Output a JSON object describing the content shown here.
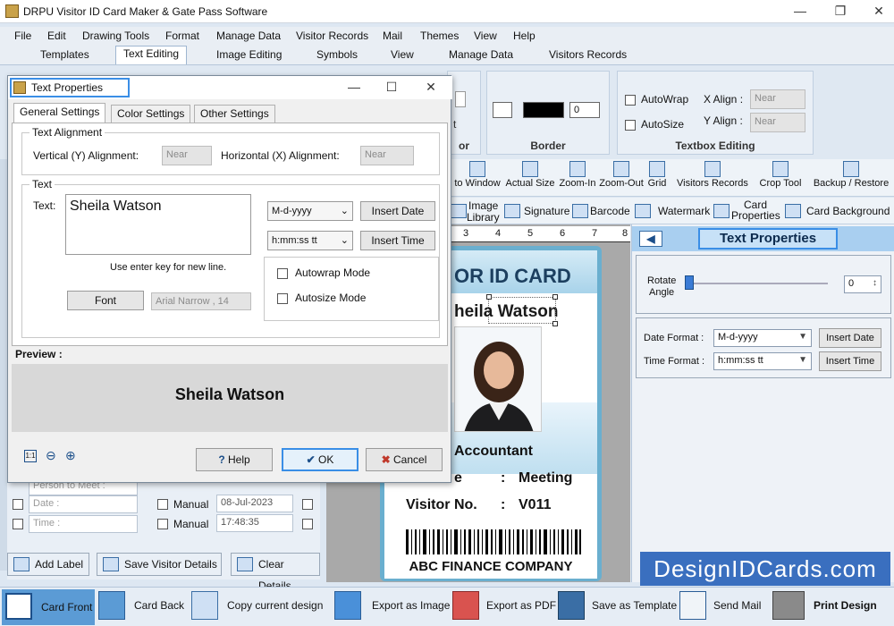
{
  "app": {
    "title": "DRPU Visitor ID Card Maker & Gate Pass Software"
  },
  "menu": [
    "File",
    "Edit",
    "Drawing Tools",
    "Format",
    "Manage Data",
    "Visitor Records",
    "Mail",
    "Themes",
    "View",
    "Help"
  ],
  "ribbon_tabs": [
    "Templates",
    "Text Editing",
    "Image Editing",
    "Symbols",
    "View",
    "Manage Data",
    "Visitors Records"
  ],
  "ribbon": {
    "border_label": "Border",
    "border_width": "0",
    "partial_label": "or",
    "textbox_label": "Textbox Editing",
    "autowrap": "AutoWrap",
    "autosize": "AutoSize",
    "x_align_label": "X Align :",
    "y_align_label": "Y Align :",
    "x_align_value": "Near",
    "y_align_value": "Near",
    "partial_t": "t"
  },
  "toolbar": [
    "to Window",
    "Actual Size",
    "Zoom-In",
    "Zoom-Out",
    "Grid",
    "Visitors Records",
    "Crop Tool",
    "Backup / Restore"
  ],
  "toolbar3": {
    "image_library_1": "Image",
    "image_library_2": "Library",
    "signature": "Signature",
    "barcode": "Barcode",
    "watermark": "Watermark",
    "card_properties_1": "Card",
    "card_properties_2": "Properties",
    "card_background": "Card Background"
  },
  "ruler": [
    "3",
    "4",
    "5",
    "6",
    "7",
    "8"
  ],
  "card": {
    "header": "OR ID CARD",
    "name": "heila Watson",
    "role": "Accountant",
    "purpose_label": "e",
    "purpose_sep": ":",
    "purpose_value": "Meeting",
    "visitor_label": "Visitor No.",
    "visitor_sep": ":",
    "visitor_value": "V011",
    "company": "ABC FINANCE COMPANY"
  },
  "right_panel": {
    "title": "Text Properties",
    "rotate_label_1": "Rotate",
    "rotate_label_2": "Angle",
    "rotate_value": "0",
    "date_format_label": "Date Format :",
    "date_format_value": "M-d-yyyy",
    "time_format_label": "Time Format :",
    "time_format_value": "h:mm:ss tt",
    "insert_date": "Insert Date",
    "insert_time": "Insert Time"
  },
  "brand": "DesignIDCards.com",
  "dialog": {
    "title": "Text Properties",
    "tabs": [
      "General Settings",
      "Color Settings",
      "Other Settings"
    ],
    "alignment_legend": "Text Alignment",
    "vertical_label": "Vertical (Y) Alignment:",
    "vertical_value": "Near",
    "horizontal_label": "Horizontal (X) Alignment:",
    "horizontal_value": "Near",
    "text_legend": "Text",
    "text_label": "Text:",
    "text_value": "Sheila Watson",
    "date_format": "M-d-yyyy",
    "time_format": "h:mm:ss tt",
    "insert_date": "Insert Date",
    "insert_time": "Insert Time",
    "hint": "Use enter key for new line.",
    "font_button": "Font",
    "font_value": "Arial Narrow , 14",
    "autowrap": "Autowrap Mode",
    "autosize": "Autosize Mode",
    "preview_label": "Preview :",
    "preview_text": "Sheila Watson",
    "help": "Help",
    "ok": "OK",
    "cancel": "Cancel"
  },
  "left_form": {
    "person_to_meet": "Person to Meet :",
    "date": "Date :",
    "time": "Time :",
    "manual_1": "Manual",
    "manual_2": "Manual",
    "date_value": "08-Jul-2023",
    "time_value": "17:48:35",
    "add_label": "Add Label",
    "save_visitor": "Save Visitor Details",
    "clear_details": "Clear Details"
  },
  "bottom": [
    "Card Front",
    "Card Back",
    "Copy current design",
    "Export as Image",
    "Export as PDF",
    "Save as Template",
    "Send Mail",
    "Print Design"
  ],
  "colors": {
    "accent": "#3a8ee6",
    "card_border": "#6aafcf",
    "brand_bg": "#3a6fbf"
  }
}
